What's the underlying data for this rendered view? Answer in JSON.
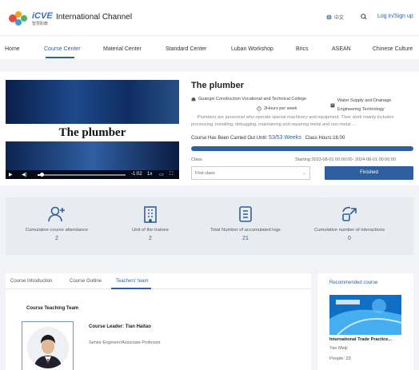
{
  "header": {
    "logo_text": "iCVE",
    "logo_sub": "智慧职教",
    "channel": "International Channel",
    "lang_label": "中文",
    "login": "Log in/Sign up"
  },
  "nav": {
    "items": [
      "Home",
      "Course Center",
      "Material Center",
      "Standard Center",
      "Luban Workshop",
      "Brics",
      "ASEAN",
      "Chinese Culture"
    ],
    "active_index": 1
  },
  "course": {
    "video_title": "The plumber",
    "video_time": "-1:02",
    "video_speed": "1x",
    "video_progress": 0.05,
    "title": "The plumber",
    "school": "Guangxi Construction Vocational and Technical College",
    "category": "Water Supply and Drainage Engineering Technology",
    "hours_per_week": "2Hours per week",
    "description": "Plumbers are personnel who operate special machinery and equipment. Their work mainly includes processing, installing, debugging, maintaining and repairing metal and non-metal ...",
    "carried_label": "Course Has Been Carried Out Until:",
    "carried_value": "53/53 Weeks",
    "class_hours_label": "Class Hours:",
    "class_hours_value": "18.00",
    "progress": 1.0,
    "class_label": "Class",
    "starting": "Starting:2023-08-01 00:00:00- 2024-08-01 00:00:00",
    "class_select": "First class",
    "finished_button": "Finished"
  },
  "stats": [
    {
      "label": "Cumulative course attendance",
      "value": "2",
      "icon": "user-add-icon"
    },
    {
      "label": "Unit of the trainee",
      "value": "2",
      "icon": "building-icon"
    },
    {
      "label": "Total Number of accumulated logs",
      "value": "21",
      "icon": "log-list-icon"
    },
    {
      "label": "Cumulative number of interactions",
      "value": "0",
      "icon": "interaction-icon"
    }
  ],
  "tabs": {
    "items": [
      "Course Introduction",
      "Course Outline",
      "Teachers' team"
    ],
    "active_index": 2,
    "team_heading": "Course Teaching Team",
    "leader": "Course Leader: Tian Haitao",
    "leader_title": "Senior Engineer/Associate Professor"
  },
  "recommended": {
    "heading": "Recommended course",
    "title": "International Trade Practice...",
    "teacher": "Yan Meiji",
    "people_label": "People:",
    "people_value": "23"
  },
  "colors": {
    "accent": "#2e5f9f",
    "background": "#f1f3f6",
    "stats_bg": "#e8ecf1"
  }
}
